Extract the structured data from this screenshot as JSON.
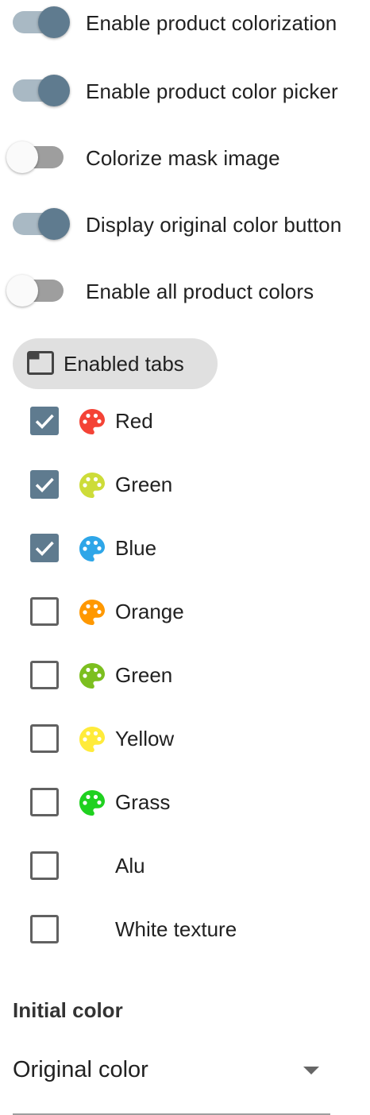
{
  "toggles": [
    {
      "label": "Enable product colorization",
      "on": true
    },
    {
      "label": "Enable product color picker",
      "on": true
    },
    {
      "label": "Colorize mask image",
      "on": false
    },
    {
      "label": "Display original color button",
      "on": true
    },
    {
      "label": "Enable all product colors",
      "on": false
    }
  ],
  "tabs_chip": {
    "label": "Enabled tabs",
    "icon": "tab-icon"
  },
  "colors": [
    {
      "label": "Red",
      "checked": true,
      "swatch": "#f44336",
      "icon": "palette-icon"
    },
    {
      "label": "Green",
      "checked": true,
      "swatch": "#cddc39",
      "icon": "palette-icon"
    },
    {
      "label": "Blue",
      "checked": true,
      "swatch": "#2ea6e8",
      "icon": "palette-icon"
    },
    {
      "label": "Orange",
      "checked": false,
      "swatch": "#ff9800",
      "icon": "palette-icon"
    },
    {
      "label": "Green",
      "checked": false,
      "swatch": "#7cbf1f",
      "icon": "palette-icon"
    },
    {
      "label": "Yellow",
      "checked": false,
      "swatch": "#ffeb3b",
      "icon": "palette-icon"
    },
    {
      "label": "Grass",
      "checked": false,
      "swatch": "#1fd11f",
      "icon": "palette-icon"
    },
    {
      "label": "Alu",
      "checked": false,
      "swatch": null
    },
    {
      "label": "White texture",
      "checked": false,
      "swatch": null
    }
  ],
  "initial_color": {
    "label": "Initial color",
    "value": "Original color",
    "icon": "dropdown-arrow-icon"
  },
  "theme": {
    "accent": "#5f7b8f",
    "track_on": "#a9b9c4",
    "track_off": "#9e9e9e"
  }
}
